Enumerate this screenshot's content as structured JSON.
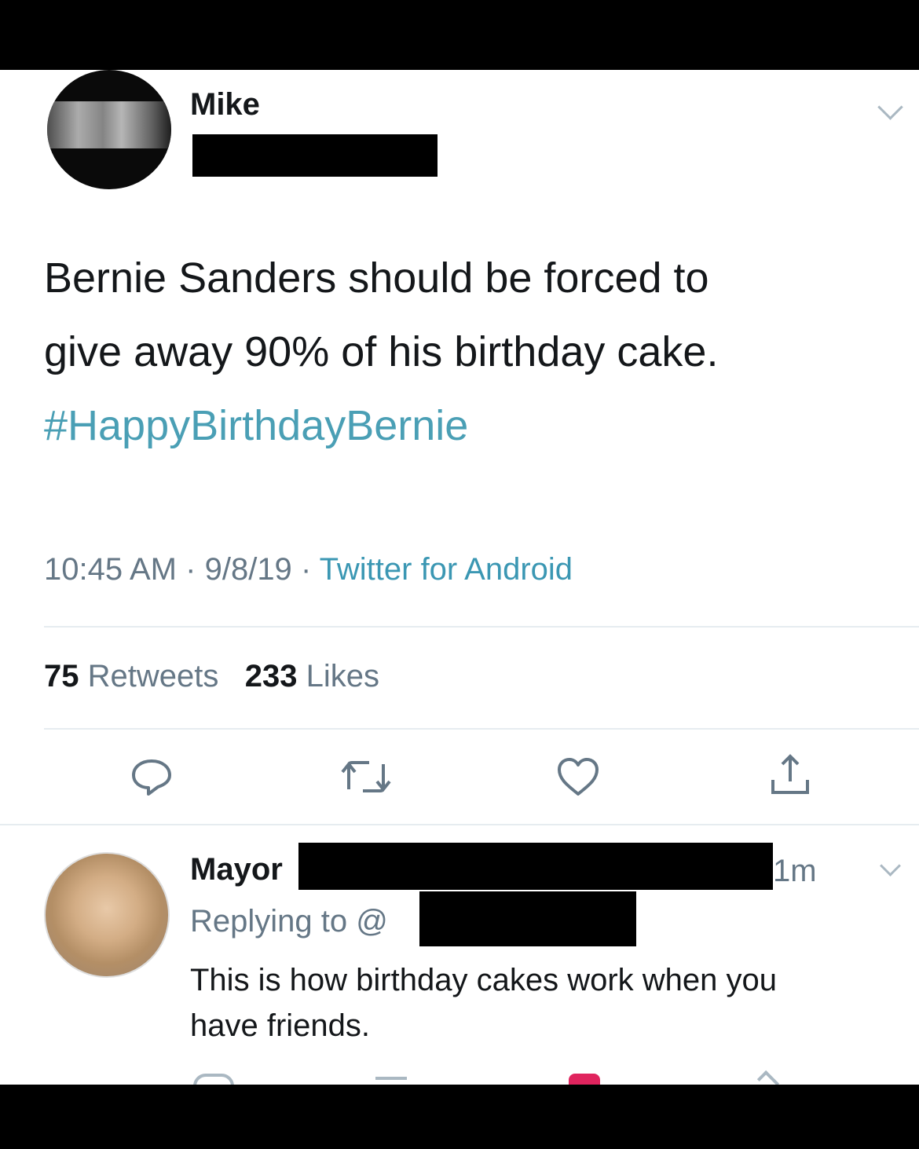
{
  "tweet": {
    "author_name": "Mike",
    "text_line1": "Bernie Sanders should be forced to",
    "text_line2": "give away 90% of his birthday cake.",
    "hashtag": "#HappyBirthdayBernie",
    "time": "10:45 AM",
    "date": "9/8/19",
    "separator": "·",
    "source": "Twitter for Android",
    "retweet_count": "75",
    "retweet_label": "Retweets",
    "like_count": "233",
    "like_label": "Likes"
  },
  "actions": {
    "icons": [
      "reply-icon",
      "retweet-icon",
      "like-icon",
      "share-icon"
    ]
  },
  "reply": {
    "author_name": "Mayor",
    "time_ago": "1m",
    "replying_prefix": "Replying to @",
    "text_line1": "This is how birthday cakes work when you",
    "text_line2": "have friends."
  },
  "colors": {
    "hashtag": "#4a9fb5",
    "meta": "#657786",
    "divider": "#e6ecf0",
    "text": "#14171a"
  }
}
